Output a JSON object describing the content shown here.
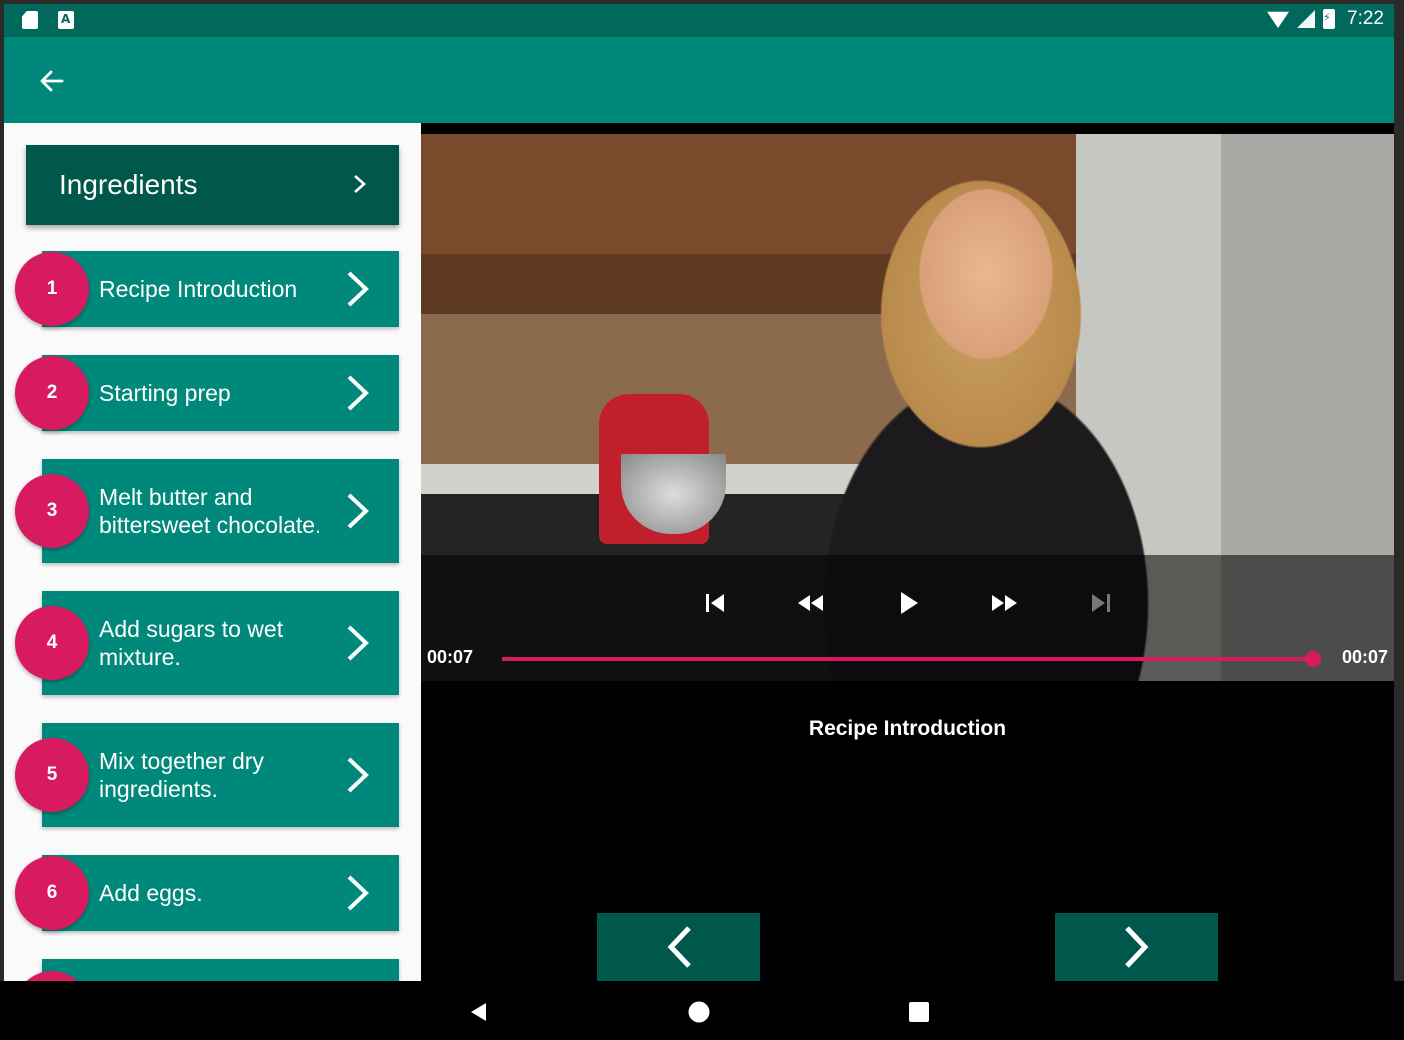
{
  "status_bar": {
    "left_icons": [
      "sd-card-icon",
      "a-letter-icon"
    ],
    "right_icons": [
      "wifi-icon",
      "signal-icon",
      "battery-charging-icon"
    ],
    "time": "7:22"
  },
  "app_bar": {
    "back_icon": "arrow-back-icon"
  },
  "sidebar": {
    "ingredients_label": "Ingredients",
    "steps": [
      {
        "number": "1",
        "text": "Recipe Introduction"
      },
      {
        "number": "2",
        "text": "Starting prep"
      },
      {
        "number": "3",
        "text": "Melt butter and\nbittersweet chocolate."
      },
      {
        "number": "4",
        "text": "Add sugars to wet\nmixture."
      },
      {
        "number": "5",
        "text": "Mix together dry\ningredients."
      },
      {
        "number": "6",
        "text": "Add eggs."
      }
    ]
  },
  "player": {
    "position": "00:07",
    "duration": "00:07",
    "progress": 1.0,
    "controls": [
      "skip-previous-icon",
      "rewind-icon",
      "play-icon",
      "fast-forward-icon",
      "skip-next-icon"
    ]
  },
  "step_title": "Recipe Introduction",
  "colors": {
    "primary": "#00897b",
    "primary_dark": "#00695c",
    "accent_dark": "#00574b",
    "pink": "#d81b60"
  },
  "system_nav": [
    "nav-back-icon",
    "nav-home-icon",
    "nav-recents-icon"
  ]
}
